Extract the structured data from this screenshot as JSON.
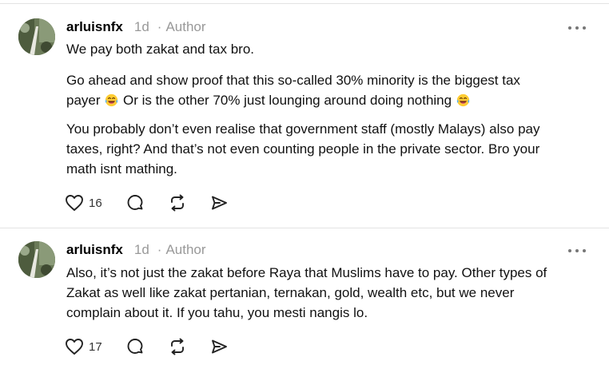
{
  "comments": [
    {
      "username": "arluisnfx",
      "time": "1d",
      "separator": "·",
      "tag": "Author",
      "paragraphs": [
        [
          "We pay both zakat and tax bro."
        ],
        [
          "Go ahead and show proof that this so-called 30% minority is the biggest tax",
          "payer ",
          " Or is the other 70% just lounging around doing nothing "
        ],
        [
          "You probably don’t even realise that government staff (mostly Malays) also pay",
          "taxes, right? And that’s not even counting people in the private sector. Bro your",
          "math isnt mathing."
        ]
      ],
      "like_count": "16",
      "icons": {
        "like": "heart-icon",
        "reply": "speech-bubble-icon",
        "repost": "repost-icon",
        "share": "send-icon",
        "more": "more-dots-icon",
        "emoji": "laughing-crying-emoji"
      }
    },
    {
      "username": "arluisnfx",
      "time": "1d",
      "separator": "·",
      "tag": "Author",
      "paragraphs": [
        [
          "Also, it’s not just the zakat before Raya that Muslims have to pay. Other types of",
          "Zakat as well like zakat pertanian, ternakan, gold, wealth etc, but we never",
          "complain about it. If you tahu, you mesti nangis lo."
        ]
      ],
      "like_count": "17",
      "icons": {
        "like": "heart-icon",
        "reply": "speech-bubble-icon",
        "repost": "repost-icon",
        "share": "send-icon",
        "more": "more-dots-icon"
      }
    }
  ],
  "colors": {
    "text": "#111111",
    "muted": "#999999",
    "divider": "#e3e3e3"
  }
}
